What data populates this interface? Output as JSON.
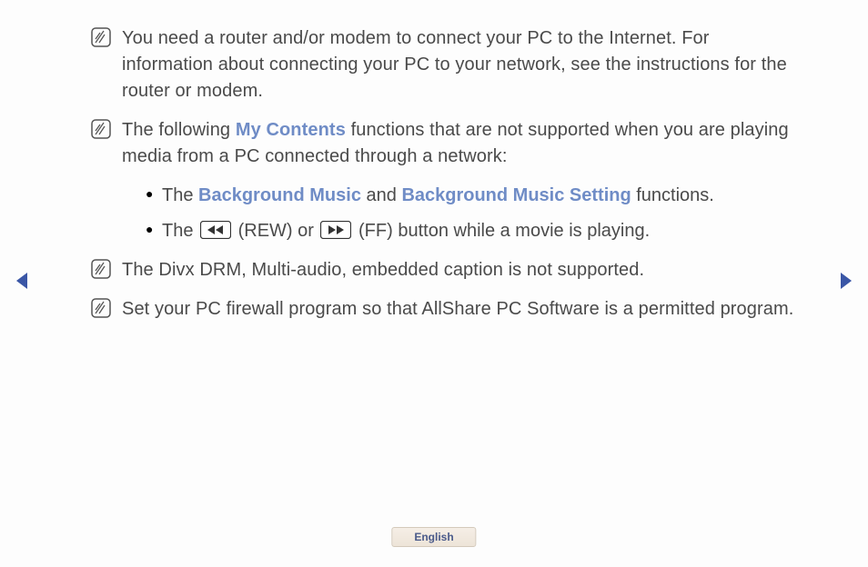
{
  "notes": [
    {
      "text": "You need a router and/or modem to connect your PC to the Internet. For information about connecting your PC to your network, see the instructions for the router or modem."
    },
    {
      "prefix": "The following ",
      "hl1": "My Contents",
      "suffix": " functions that are not supported when you are playing media from a PC connected through a network:"
    },
    {
      "text": "The Divx DRM, Multi-audio, embedded caption is not supported."
    },
    {
      "text": "Set your PC firewall program so that AllShare PC Software is a permitted program."
    }
  ],
  "sub": {
    "a_prefix": "The ",
    "a_hl1": "Background Music",
    "a_mid": " and ",
    "a_hl2": "Background Music Setting",
    "a_suffix": " functions.",
    "b_prefix": "The ",
    "b_rew": " (REW) or ",
    "b_ff": " (FF) button while a movie is playing."
  },
  "language": "English"
}
